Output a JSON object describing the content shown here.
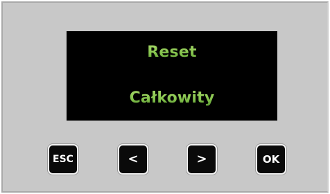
{
  "display": {
    "line1": "Reset",
    "line2": "Całkowity",
    "text_color": "#84c34c",
    "background_color": "#000000"
  },
  "keys": {
    "esc": "ESC",
    "prev": "<",
    "next": ">",
    "ok": "OK"
  },
  "colors": {
    "panel": "#c8c8c8",
    "key_face": "#0a0a0a",
    "key_border": "#f4f4f4"
  }
}
